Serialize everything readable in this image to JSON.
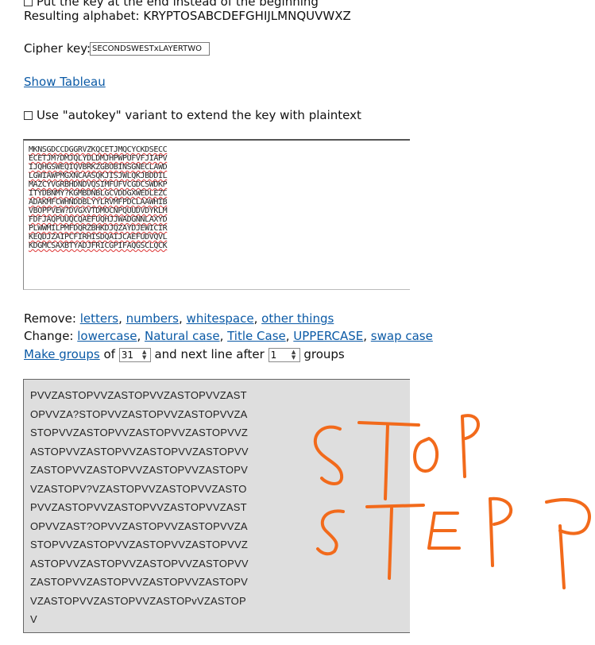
{
  "top": {
    "cut_option_label": "Put the key at the end instead of the beginning",
    "resulting_alphabet_label": "Resulting alphabet:",
    "resulting_alphabet_value": "KRYPTOSABCDEFGHIJLMNQUVWXZ"
  },
  "cipher_key": {
    "label": "Cipher key:",
    "value": "SECONDSWESTxLAYERTWO"
  },
  "show_tableau": "Show Tableau",
  "autokey_label": "Use \"autokey\" variant to extend the key with plaintext",
  "ciphertext_lines": [
    "MKNSGDCCDGGRVZKQCETJMQCYCKDSECC",
    "ECETJM?DMJQLYDLDMJHPWPUFVFJIAPV",
    "IJQHGSWEQIQVBRKZGBOBINSGNECLAWD",
    "LGWIAWPMGXNCAASQKJISJWLQKJBDDIL",
    "MAZCYVGRBHDNDVQSIMFUFVCGDCSWDKP",
    "ITYDBNMY?KGMBDNBLGCVDDGXWEDLEZC",
    "ADAKMFCWHNDDBLYYLRVMFPDCLAAWHIB",
    "VBOPPVEW?DVGXVTDMOCNPQUUDVDYKLM",
    "FDFJAQPUUQCQAEFUQHJJWADGNNLAXYD",
    "PLWWMILPMFDQRZBHKDJQZAYDJEWICIR",
    "KEQDJZAIPCFIRHISDQAIJCAEFUDVQVL",
    "KDGMCSAXBTYADJFRICGPIFAQGSCLQCK"
  ],
  "remove": {
    "label": "Remove:",
    "links": [
      "letters",
      "numbers",
      "whitespace",
      "other things"
    ]
  },
  "change": {
    "label": "Change:",
    "links": [
      "lowercase",
      "Natural case",
      "Title Case",
      "UPPERCASE",
      "swap case"
    ]
  },
  "groups": {
    "link": "Make groups",
    "of": "of",
    "group_size": "31",
    "next_line_text": "and next line after",
    "line_after": "1",
    "suffix": "groups"
  },
  "output_lines": [
    "PVVZASTOPVVZASTOPVVZASTOPVVZAST",
    "OPVVZA?STOPVVZASTOPVVZASTOPVVZA",
    "STOPVVZASTOPVVZASTOPVVZASTOPVVZ",
    "ASTOPVVZASTOPVVZASTOPVVZASTOPVV",
    "ZASTOPVVZASTOPVVZASTOPVVZASTOPV",
    "VZASTOPV?VZASTOPVVZASTOPVVZASTO",
    "PVVZASTOPVVZASTOPVVZASTOPVVZAST",
    "OPVVZAST?OPVVZASTOPVVZASTOPVVZA",
    "STOPVVZASTOPVVZASTOPVVZASTOPVVZ",
    "ASTOPVVZASTOPVVZASTOPVVZASTOPVV",
    "ZASTOPVVZASTOPVVZASTOPVVZASTOPV",
    "VZASTOPVVZASTOPVVZASTOPvVZASTOP",
    "V"
  ],
  "colors": {
    "link": "#0b5aa6",
    "annotation": "#f26a1b",
    "output_bg": "#dedede"
  }
}
